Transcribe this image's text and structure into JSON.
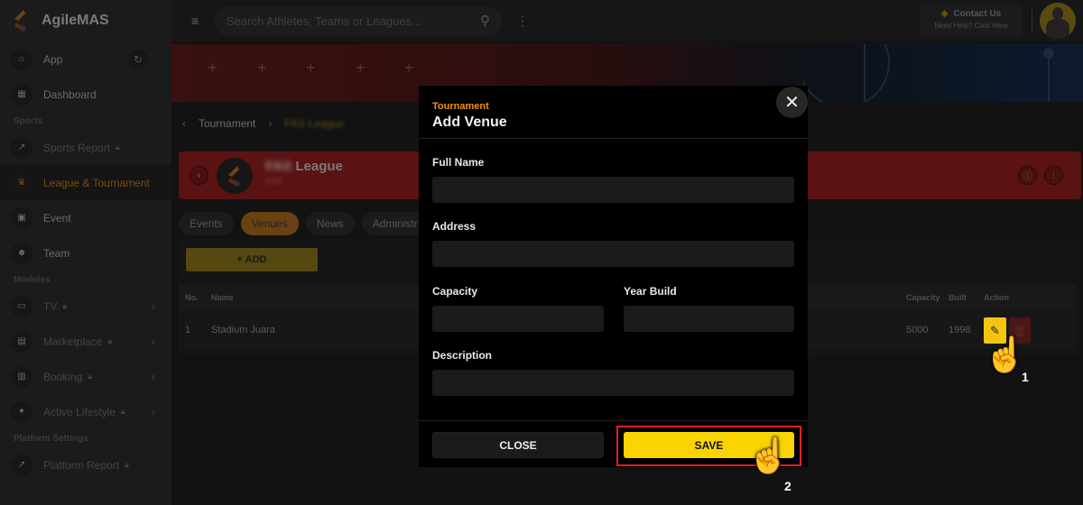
{
  "sidebar": {
    "brand": "AgileMAS",
    "items": [
      {
        "label": "App",
        "icon": "home-icon"
      },
      {
        "label": "Dashboard",
        "icon": "dashboard-icon"
      }
    ],
    "sections": [
      {
        "title": "Sports",
        "items": [
          {
            "label": "Sports Report",
            "icon": "trend-icon",
            "locked": true
          },
          {
            "label": "League & Tournament",
            "icon": "trophy-icon",
            "active": true
          },
          {
            "label": "Event",
            "icon": "ticket-icon"
          },
          {
            "label": "Team",
            "icon": "team-icon"
          }
        ]
      },
      {
        "title": "Modules",
        "items": [
          {
            "label": "TV",
            "icon": "tv-icon",
            "locked": true
          },
          {
            "label": "Marketplace",
            "icon": "store-icon",
            "locked": true
          },
          {
            "label": "Booking",
            "icon": "building-icon",
            "locked": true
          },
          {
            "label": "Active Lifestyle",
            "icon": "run-icon",
            "locked": true
          }
        ]
      },
      {
        "title": "Platform Settings",
        "items": [
          {
            "label": "Platform Report",
            "icon": "trend-icon",
            "locked": true
          }
        ]
      }
    ]
  },
  "topbar": {
    "search_placeholder": "Search Athletes, Teams or Leagues...",
    "contact_title": "Contact Us",
    "contact_sub": "Need Help? Click Here"
  },
  "breadcrumb": {
    "parent": "Tournament",
    "current": "FAS League"
  },
  "league": {
    "name_prefix": "FAS",
    "name": "League",
    "sub": "FAS"
  },
  "tabs": [
    "Events",
    "Venues",
    "News",
    "Administr"
  ],
  "add_button": "+ ADD",
  "table": {
    "columns": [
      "No.",
      "Name",
      "Capacity",
      "Built",
      "Action"
    ],
    "rows": [
      {
        "no": "1",
        "name": "Stadium Juara",
        "capacity": "5000",
        "built": "1998"
      }
    ]
  },
  "modal": {
    "kicker": "Tournament",
    "title": "Add Venue",
    "fields": {
      "full_name": {
        "label": "Full Name",
        "value": ""
      },
      "address": {
        "label": "Address",
        "value": ""
      },
      "capacity": {
        "label": "Capacity",
        "value": ""
      },
      "year_build": {
        "label": "Year Build",
        "value": ""
      },
      "description": {
        "label": "Description",
        "value": ""
      }
    },
    "close_label": "CLOSE",
    "save_label": "SAVE"
  },
  "annotations": {
    "step1": "1",
    "step2": "2"
  },
  "colors": {
    "accent": "#fad400",
    "kicker": "#f5920a",
    "highlight": "#e02020",
    "league_banner": "#5a1212"
  }
}
